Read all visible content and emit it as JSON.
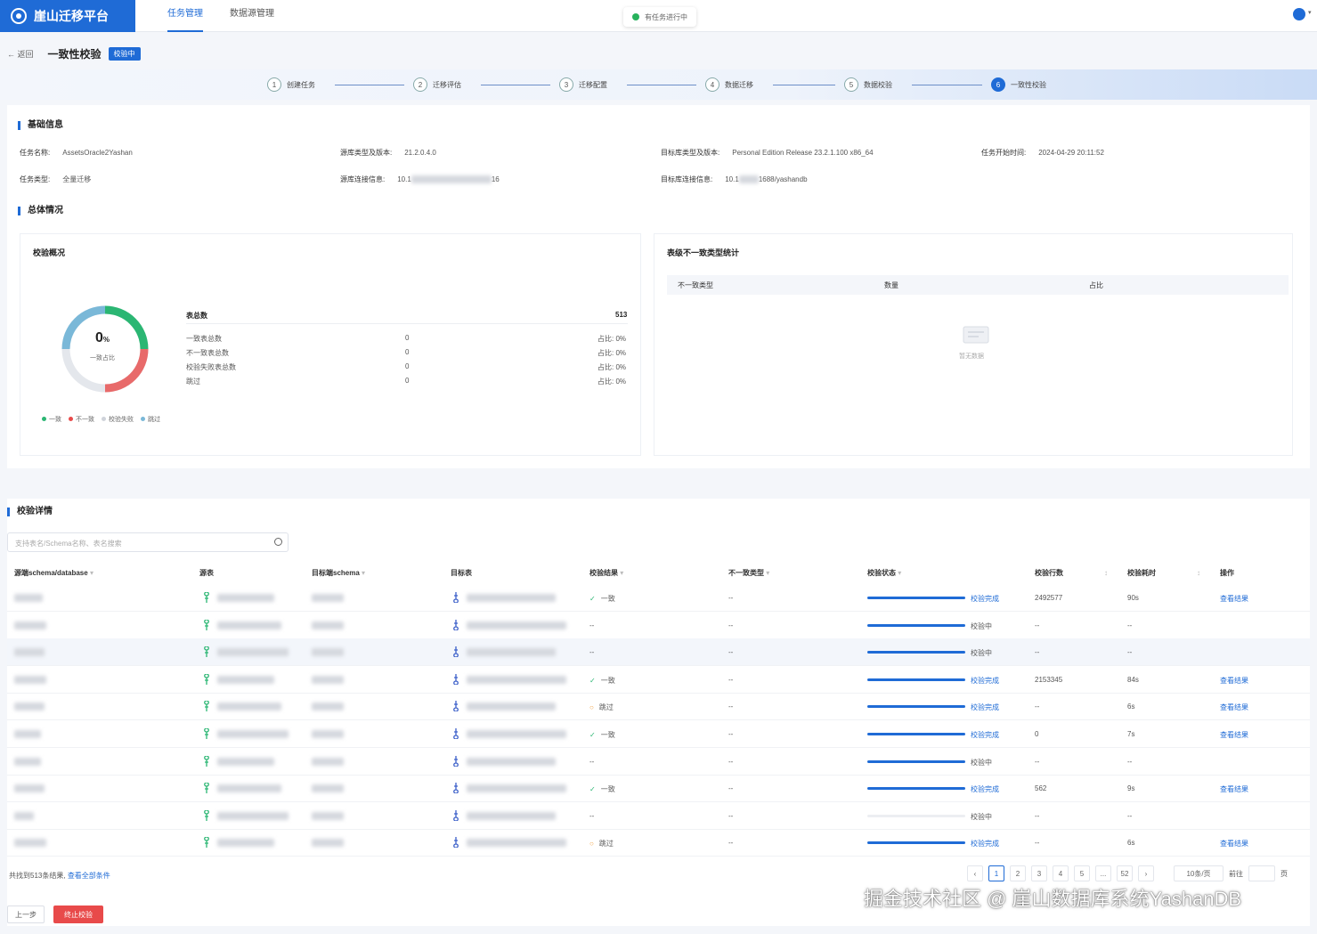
{
  "app": {
    "title": "崖山迁移平台",
    "nav": [
      "任务管理",
      "数据源管理"
    ],
    "task_status": "有任务进行中"
  },
  "header": {
    "back": "← 返回",
    "title": "一致性校验",
    "badge": "校验中"
  },
  "steps": [
    {
      "num": "1",
      "label": "创建任务"
    },
    {
      "num": "2",
      "label": "迁移评估"
    },
    {
      "num": "3",
      "label": "迁移配置"
    },
    {
      "num": "4",
      "label": "数据迁移"
    },
    {
      "num": "5",
      "label": "数据校验"
    },
    {
      "num": "6",
      "label": "一致性校验"
    }
  ],
  "basic": {
    "section": "基础信息",
    "task_name_label": "任务名称:",
    "task_name": "AssetsOracle2Yashan",
    "task_type_label": "任务类型:",
    "task_type": "全量迁移",
    "src_ver_label": "源库类型及版本:",
    "src_ver": "21.2.0.4.0",
    "src_conn_label": "源库连接信息:",
    "src_conn": "10.1",
    "src_conn_tail": "16",
    "tgt_ver_label": "目标库类型及版本:",
    "tgt_ver": "Personal Edition Release 23.2.1.100 x86_64",
    "tgt_conn_label": "目标库连接信息:",
    "tgt_conn": "10.1",
    "tgt_conn_tail": "1688/yashandb",
    "start_label": "任务开始时间:",
    "start": "2024-04-29 20:11:52"
  },
  "overview": {
    "section": "总体情况",
    "card_title": "校验概况",
    "donut_value": "0",
    "donut_unit": "%",
    "donut_label": "一致占比",
    "total_label": "表总数",
    "total": "513",
    "rows": [
      {
        "label": "一致表总数",
        "count": "0",
        "pct": "占比: 0%"
      },
      {
        "label": "不一致表总数",
        "count": "0",
        "pct": "占比: 0%"
      },
      {
        "label": "校验失败表总数",
        "count": "0",
        "pct": "占比: 0%"
      },
      {
        "label": "跳过",
        "count": "0",
        "pct": "占比: 0%"
      }
    ],
    "legend": [
      {
        "label": "一致",
        "color": "#2bb673"
      },
      {
        "label": "不一致",
        "color": "#e84a4a"
      },
      {
        "label": "校验失败",
        "color": "#cfd3da"
      },
      {
        "label": "跳过",
        "color": "#7ab8d8"
      }
    ]
  },
  "inconsistent": {
    "card_title": "表级不一致类型统计",
    "cols": [
      "不一致类型",
      "数量",
      "占比"
    ],
    "empty": "暂无数据"
  },
  "detail": {
    "section": "校验详情",
    "search_placeholder": "支持表名/Schema名称、表名搜索",
    "columns": [
      "源端schema/database",
      "源表",
      "目标端schema",
      "目标表",
      "校验结果",
      "不一致类型",
      "校验状态",
      "校验行数",
      "校验耗时",
      "操作"
    ],
    "rows": [
      {
        "result": "一致",
        "rtype": "ok",
        "itype": "--",
        "status": "校验完成",
        "slink": true,
        "rowsn": "2492577",
        "time": "90s",
        "op": "查看结果",
        "bar": true
      },
      {
        "result": "--",
        "rtype": "",
        "itype": "--",
        "status": "校验中",
        "slink": false,
        "rowsn": "--",
        "time": "--",
        "op": "",
        "bar": true
      },
      {
        "result": "--",
        "rtype": "",
        "itype": "--",
        "status": "校验中",
        "slink": false,
        "rowsn": "--",
        "time": "--",
        "op": "",
        "bar": true
      },
      {
        "result": "一致",
        "rtype": "ok",
        "itype": "--",
        "status": "校验完成",
        "slink": true,
        "rowsn": "2153345",
        "time": "84s",
        "op": "查看结果",
        "bar": true
      },
      {
        "result": "跳过",
        "rtype": "skip",
        "itype": "--",
        "status": "校验完成",
        "slink": true,
        "rowsn": "--",
        "time": "6s",
        "op": "查看结果",
        "bar": true
      },
      {
        "result": "一致",
        "rtype": "ok",
        "itype": "--",
        "status": "校验完成",
        "slink": true,
        "rowsn": "0",
        "time": "7s",
        "op": "查看结果",
        "bar": true
      },
      {
        "result": "--",
        "rtype": "",
        "itype": "--",
        "status": "校验中",
        "slink": false,
        "rowsn": "--",
        "time": "--",
        "op": "",
        "bar": true
      },
      {
        "result": "一致",
        "rtype": "ok",
        "itype": "--",
        "status": "校验完成",
        "slink": true,
        "rowsn": "562",
        "time": "9s",
        "op": "查看结果",
        "bar": true
      },
      {
        "result": "--",
        "rtype": "",
        "itype": "--",
        "status": "校验中",
        "slink": false,
        "rowsn": "--",
        "time": "--",
        "op": "",
        "bar": false
      },
      {
        "result": "跳过",
        "rtype": "skip",
        "itype": "--",
        "status": "校验完成",
        "slink": true,
        "rowsn": "--",
        "time": "6s",
        "op": "查看结果",
        "bar": true
      }
    ],
    "footer": "共找到513条结果,",
    "footer_link": "查看全部条件",
    "pages": [
      "‹",
      "1",
      "2",
      "3",
      "4",
      "5",
      "...",
      "52",
      "›"
    ],
    "page_size": "10条/页",
    "goto": "前往",
    "page_unit": "页"
  },
  "actions": {
    "prev": "上一步",
    "end": "终止校验"
  },
  "watermark": "掘金技术社区 @ 崖山数据库系统YashanDB"
}
